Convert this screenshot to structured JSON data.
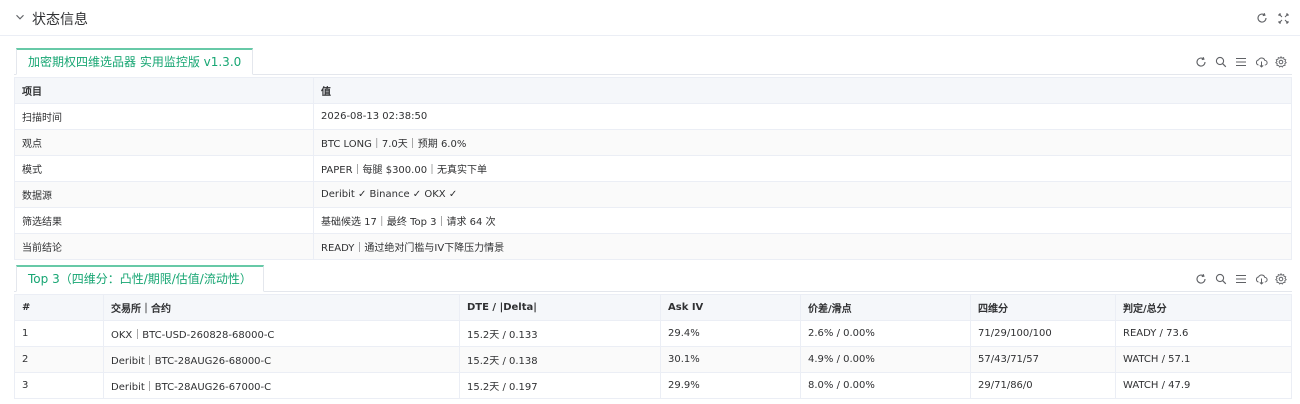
{
  "header": {
    "title": "状态信息"
  },
  "status_panel": {
    "tab_label": "加密期权四维选品器 实用监控版 v1.3.0",
    "columns": [
      "项目",
      "值"
    ],
    "rows": [
      [
        "扫描时间",
        "2026-08-13 02:38:50"
      ],
      [
        "观点",
        "BTC LONG｜7.0天｜预期 6.0%"
      ],
      [
        "模式",
        "PAPER｜每腿 $300.00｜无真实下单"
      ],
      [
        "数据源",
        "Deribit ✓  Binance ✓  OKX ✓"
      ],
      [
        "筛选结果",
        "基础候选 17｜最终 Top 3｜请求 64 次"
      ],
      [
        "当前结论",
        "READY｜通过绝对门槛与IV下降压力情景"
      ]
    ]
  },
  "top_panel": {
    "tab_label": "Top 3（四维分：凸性/期限/估值/流动性）",
    "columns": [
      "#",
      "交易所｜合约",
      "DTE / |Delta|",
      "Ask IV",
      "价差/滑点",
      "四维分",
      "判定/总分"
    ],
    "rows": [
      [
        "1",
        "OKX｜BTC-USD-260828-68000-C",
        "15.2天 / 0.133",
        "29.4%",
        "2.6% / 0.00%",
        "71/29/100/100",
        "READY / 73.6"
      ],
      [
        "2",
        "Deribit｜BTC-28AUG26-68000-C",
        "15.2天 / 0.138",
        "30.1%",
        "4.9% / 0.00%",
        "57/43/71/57",
        "WATCH / 57.1"
      ],
      [
        "3",
        "Deribit｜BTC-28AUG26-67000-C",
        "15.2天 / 0.197",
        "29.9%",
        "8.0% / 0.00%",
        "29/71/86/0",
        "WATCH / 47.9"
      ]
    ]
  },
  "icons": {
    "collapse": "chevron-down-icon",
    "refresh": "refresh-icon",
    "fullscreen": "fullscreen-icon",
    "search": "search-icon",
    "list": "list-icon",
    "cloud": "cloud-download-icon",
    "settings": "gear-icon"
  },
  "colors": {
    "accent": "#17a673",
    "border": "#ebeef5",
    "header_bg": "#f5f7fa"
  }
}
